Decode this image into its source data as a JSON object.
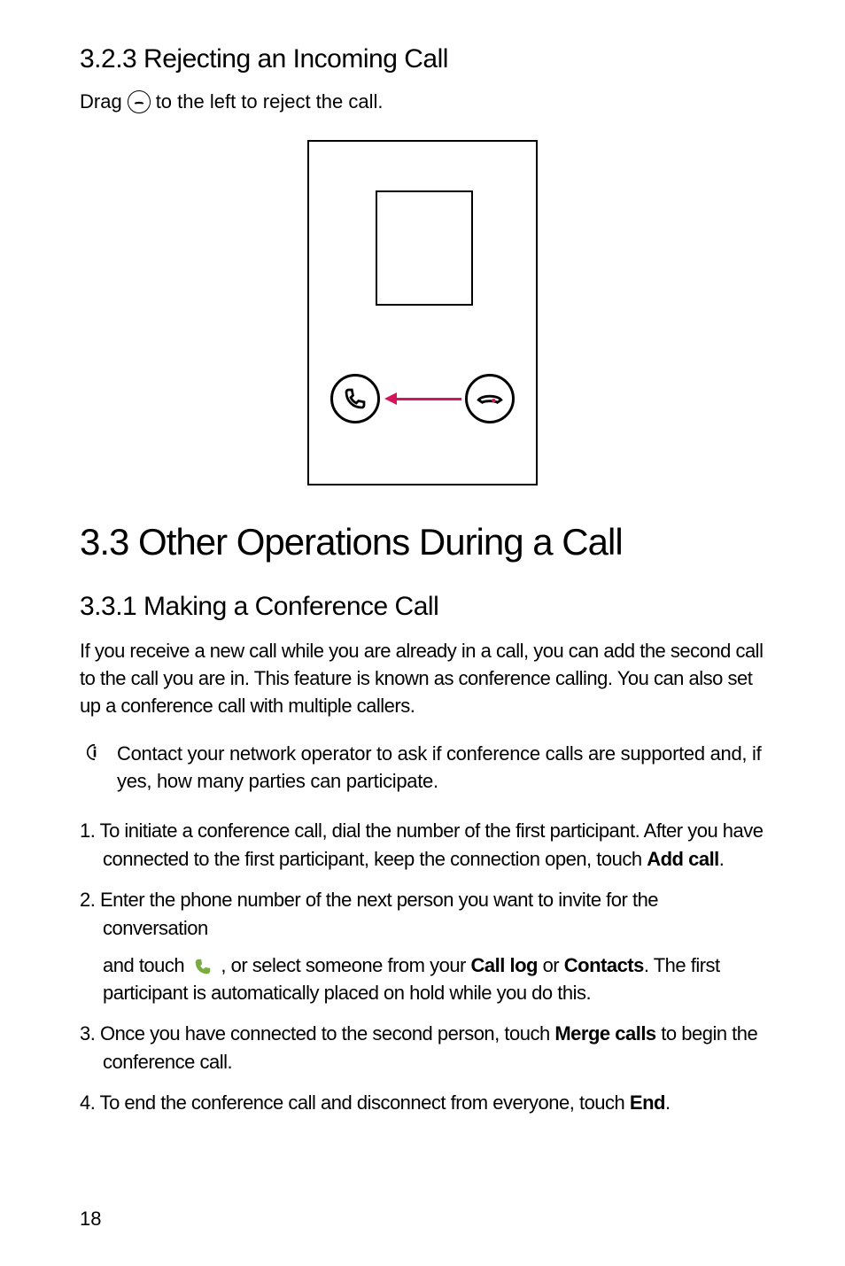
{
  "section323": {
    "heading": "3.2.3  Rejecting an Incoming Call",
    "drag_prefix": "Drag ",
    "drag_suffix": " to the left to reject the call."
  },
  "section33": {
    "heading": "3.3  Other Operations During a Call"
  },
  "section331": {
    "heading": "3.3.1  Making a Conference Call",
    "intro": "If you receive a new call while you are already in a call, you can add the second call to the call you are in. This feature is known as conference calling. You can also set up a conference call with multiple callers.",
    "note": "Contact your network operator to ask if conference calls are supported and, if yes, how many parties can participate.",
    "step1_prefix": "1. To initiate a conference call, dial the number of the first participant. After you have connected to the first participant, keep the connection open, touch ",
    "step1_bold": "Add call",
    "step1_suffix": ".",
    "step2_line1": "2. Enter the phone number of the next person you want to invite for the conversation",
    "step2_line2_prefix": "and touch ",
    "step2_line2_mid": " , or select someone from your ",
    "step2_bold1": "Call log",
    "step2_or": " or ",
    "step2_bold2": "Contacts",
    "step2_line2_suffix": ". The first participant is automatically placed on hold while you do this.",
    "step3_prefix": "3. Once you have connected to the second person, touch ",
    "step3_bold": "Merge calls",
    "step3_suffix": " to begin the conference call.",
    "step4_prefix": "4. To end the conference call and disconnect from everyone, touch ",
    "step4_bold": "End",
    "step4_suffix": "."
  },
  "page_number": "18"
}
